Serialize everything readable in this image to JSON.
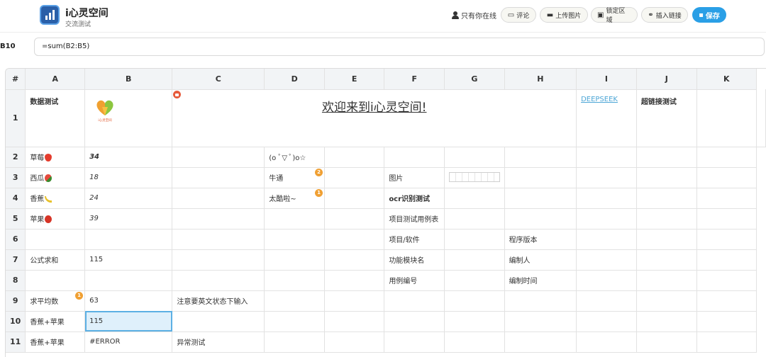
{
  "header": {
    "app_title": "i心灵空间",
    "app_subtitle": "交流测试",
    "online_label": "只有你在线",
    "buttons": {
      "comment": "评论",
      "upload_image": "上传图片",
      "lock_area": "锁定区域",
      "insert_link": "插入链接",
      "save": "保存"
    },
    "colors": {
      "save_bg": "#2a9fe6",
      "accent": "#2a9fe6"
    }
  },
  "formula_bar": {
    "cell_ref": "B10",
    "formula": "=sum(B2:B5)"
  },
  "sheet": {
    "corner": "#",
    "columns": [
      "A",
      "B",
      "C",
      "D",
      "E",
      "F",
      "G",
      "H",
      "I",
      "J",
      "K"
    ],
    "rows": [
      "1",
      "2",
      "3",
      "4",
      "5",
      "6",
      "7",
      "8",
      "9",
      "10",
      "11"
    ],
    "cells": {
      "A1": "数据测试",
      "B1_logo_text": "i心灵空间",
      "C1": "欢迎来到i心灵空间!",
      "H1": "DEEPSEEK",
      "I1": "超链接测试",
      "A2": "草莓",
      "B2": "34",
      "D2": "(o ﾟ▽ ﾟ)o☆",
      "A3": "西瓜",
      "B3": "18",
      "D3": "牛通",
      "D3_badge": "2",
      "F3": "图片",
      "A4": "香蕉",
      "B4": "24",
      "D4": "太酷啦~",
      "D4_badge": "1",
      "F4": "ocr识别测试",
      "A5": "苹果",
      "B5": "39",
      "F5": "项目测试用例表",
      "F6": "项目/软件",
      "H6": "程序版本",
      "A7": "公式求和",
      "B7": "115",
      "F7": "功能模块名",
      "H7": "编制人",
      "F8": "用例编号",
      "H8": "编制时间",
      "A9": "求平均数",
      "A9_badge": "1",
      "B9": "63",
      "C9": "注意要英文状态下输入",
      "A10": "香蕉+苹果",
      "B10": "115",
      "A11": "香蕉+苹果",
      "B11": "#ERROR",
      "C11": "异常测试"
    }
  }
}
